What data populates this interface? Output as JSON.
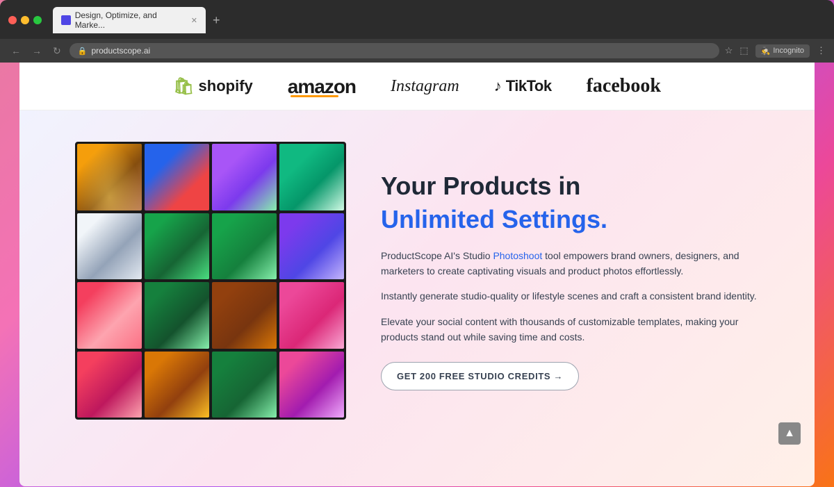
{
  "browser": {
    "tab_title": "Design, Optimize, and Marke...",
    "favicon_label": "productscope-favicon",
    "url": "productscope.ai",
    "incognito_label": "Incognito",
    "nav": {
      "back": "←",
      "forward": "→",
      "refresh": "↻",
      "new_tab": "+"
    }
  },
  "logos_bar": {
    "shopify": "shopify",
    "amazon": "amazon",
    "instagram": "Instagram",
    "tiktok": "TikTok",
    "facebook": "facebook"
  },
  "hero": {
    "headline_line1": "Your Products in",
    "headline_line2": "Unlimited Settings.",
    "description1_prefix": "ProductScope AI's Studio ",
    "description1_link": "Photoshoot",
    "description1_suffix": " tool empowers brand owners, designers, and marketers to create captivating visuals and product photos effortlessly.",
    "description2": "Instantly generate studio-quality or lifestyle scenes and craft a consistent brand identity.",
    "description3": "Elevate your social content with thousands of customizable templates, making your products stand out while saving time and costs.",
    "cta_label": "GET 200 FREE STUDIO CREDITS →"
  },
  "scroll_btn": "▲"
}
